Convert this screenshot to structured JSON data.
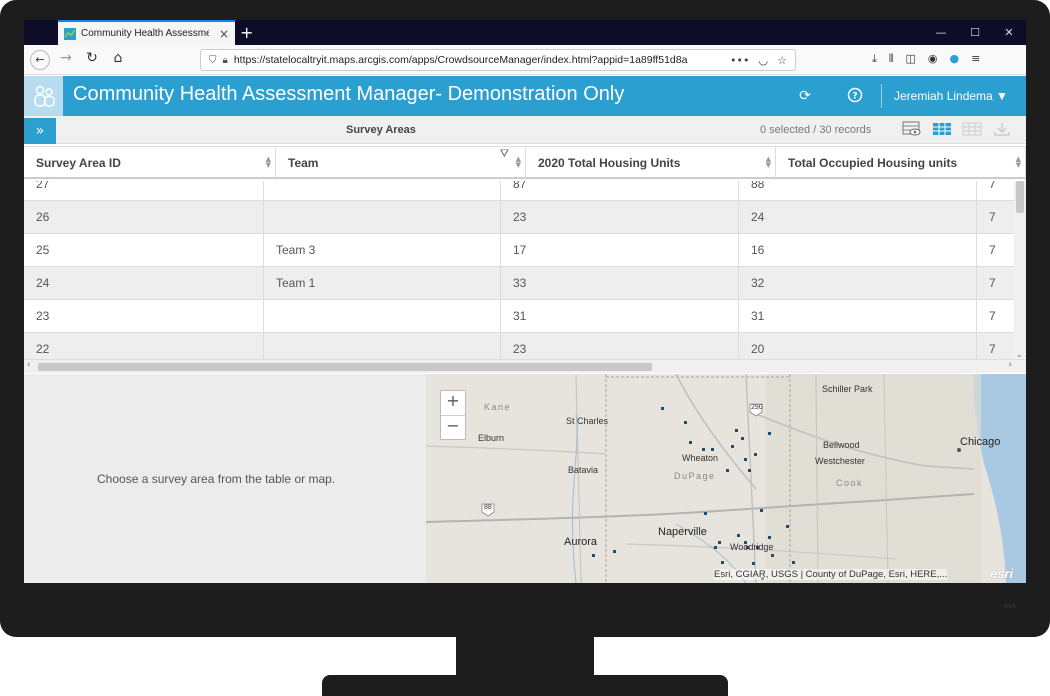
{
  "browser": {
    "tab_title": "Community Health Assessmen",
    "tab_close": "×",
    "new_tab": "+",
    "url": "https://statelocaltryit.maps.arcgis.com/apps/CrowdsourceManager/index.html?appid=1a89ff51d8a",
    "window_controls": [
      "—",
      "☐",
      "✕"
    ]
  },
  "app": {
    "title": "Community Health Assessment Manager- Demonstration Only",
    "user": "Jeremiah Lindema ▼",
    "brand_color": "#2b9fd0"
  },
  "table": {
    "title": "Survey Areas",
    "record_count": "0 selected / 30 records",
    "columns": [
      "Survey Area ID",
      "Team",
      "2020 Total Housing Units",
      "Total Occupied Housing units"
    ],
    "rows": [
      [
        "27",
        "",
        "87",
        "88",
        "7"
      ],
      [
        "26",
        "",
        "23",
        "24",
        "7"
      ],
      [
        "25",
        "Team 3",
        "17",
        "16",
        "7"
      ],
      [
        "24",
        "Team 1",
        "33",
        "32",
        "7"
      ],
      [
        "23",
        "",
        "31",
        "31",
        "7"
      ],
      [
        "22",
        "",
        "23",
        "20",
        "7"
      ]
    ]
  },
  "detail": {
    "message": "Choose a survey area from the table or map."
  },
  "map": {
    "zoom_in": "+",
    "zoom_out": "−",
    "labels": {
      "kane": "Kane",
      "st_charles": "St Charles",
      "elburn": "Elburn",
      "batavia": "Batavia",
      "wheaton": "Wheaton",
      "dupage": "DuPage",
      "naperville": "Naperville",
      "aurora": "Aurora",
      "woodridge": "Woodridge",
      "schiller_park": "Schiller Park",
      "bellwood": "Bellwood",
      "westchester": "Westchester",
      "cook": "Cook",
      "chicago": "Chicago",
      "hwy_290": "290",
      "hwy_88": "88"
    },
    "attribution": "Esri, CGIAR, USGS | County of DuPage, Esri, HERE,...",
    "esri_logo": "esri"
  },
  "monitor": {
    "brand": "esri"
  }
}
